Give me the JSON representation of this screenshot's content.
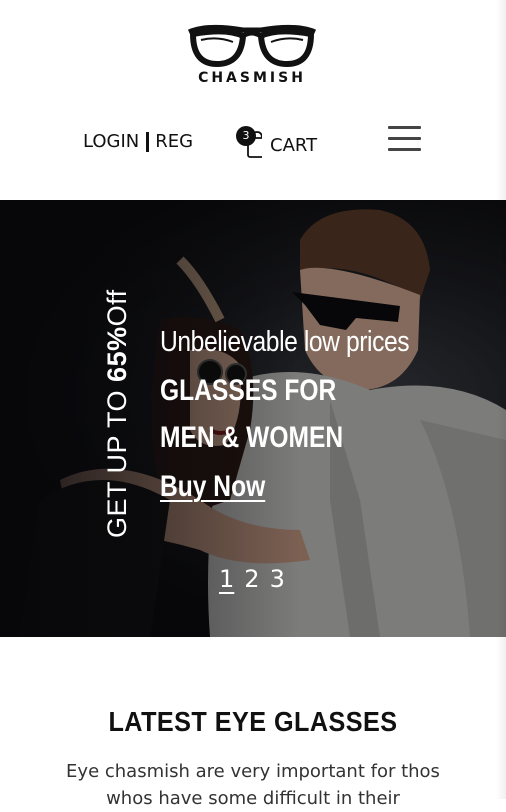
{
  "brand": {
    "name": "CHASMISH",
    "logo_icon": "glasses-icon"
  },
  "nav": {
    "login": "LOGIN",
    "register": "REG",
    "cart_count": "3",
    "cart_label": "CART",
    "cart_icon": "shopping-bag-icon",
    "menu_icon": "hamburger-menu-icon"
  },
  "hero": {
    "promo_prefix": "GET UP TO ",
    "promo_highlight": "65%",
    "promo_suffix": "Off",
    "tagline": "Unbelievable low prices",
    "headline_line1": "GLASSES FOR",
    "headline_line2": "MEN & WOMEN",
    "cta": "Buy Now",
    "pages": [
      "1",
      "2",
      "3"
    ],
    "active_page": "1"
  },
  "section": {
    "title": "LATEST EYE GLASSES",
    "text": "Eye chasmish are very important for thos whos have some difficult in their"
  },
  "colors": {
    "text": "#111111",
    "hero_bg": "#0b0b0e",
    "white": "#ffffff"
  }
}
